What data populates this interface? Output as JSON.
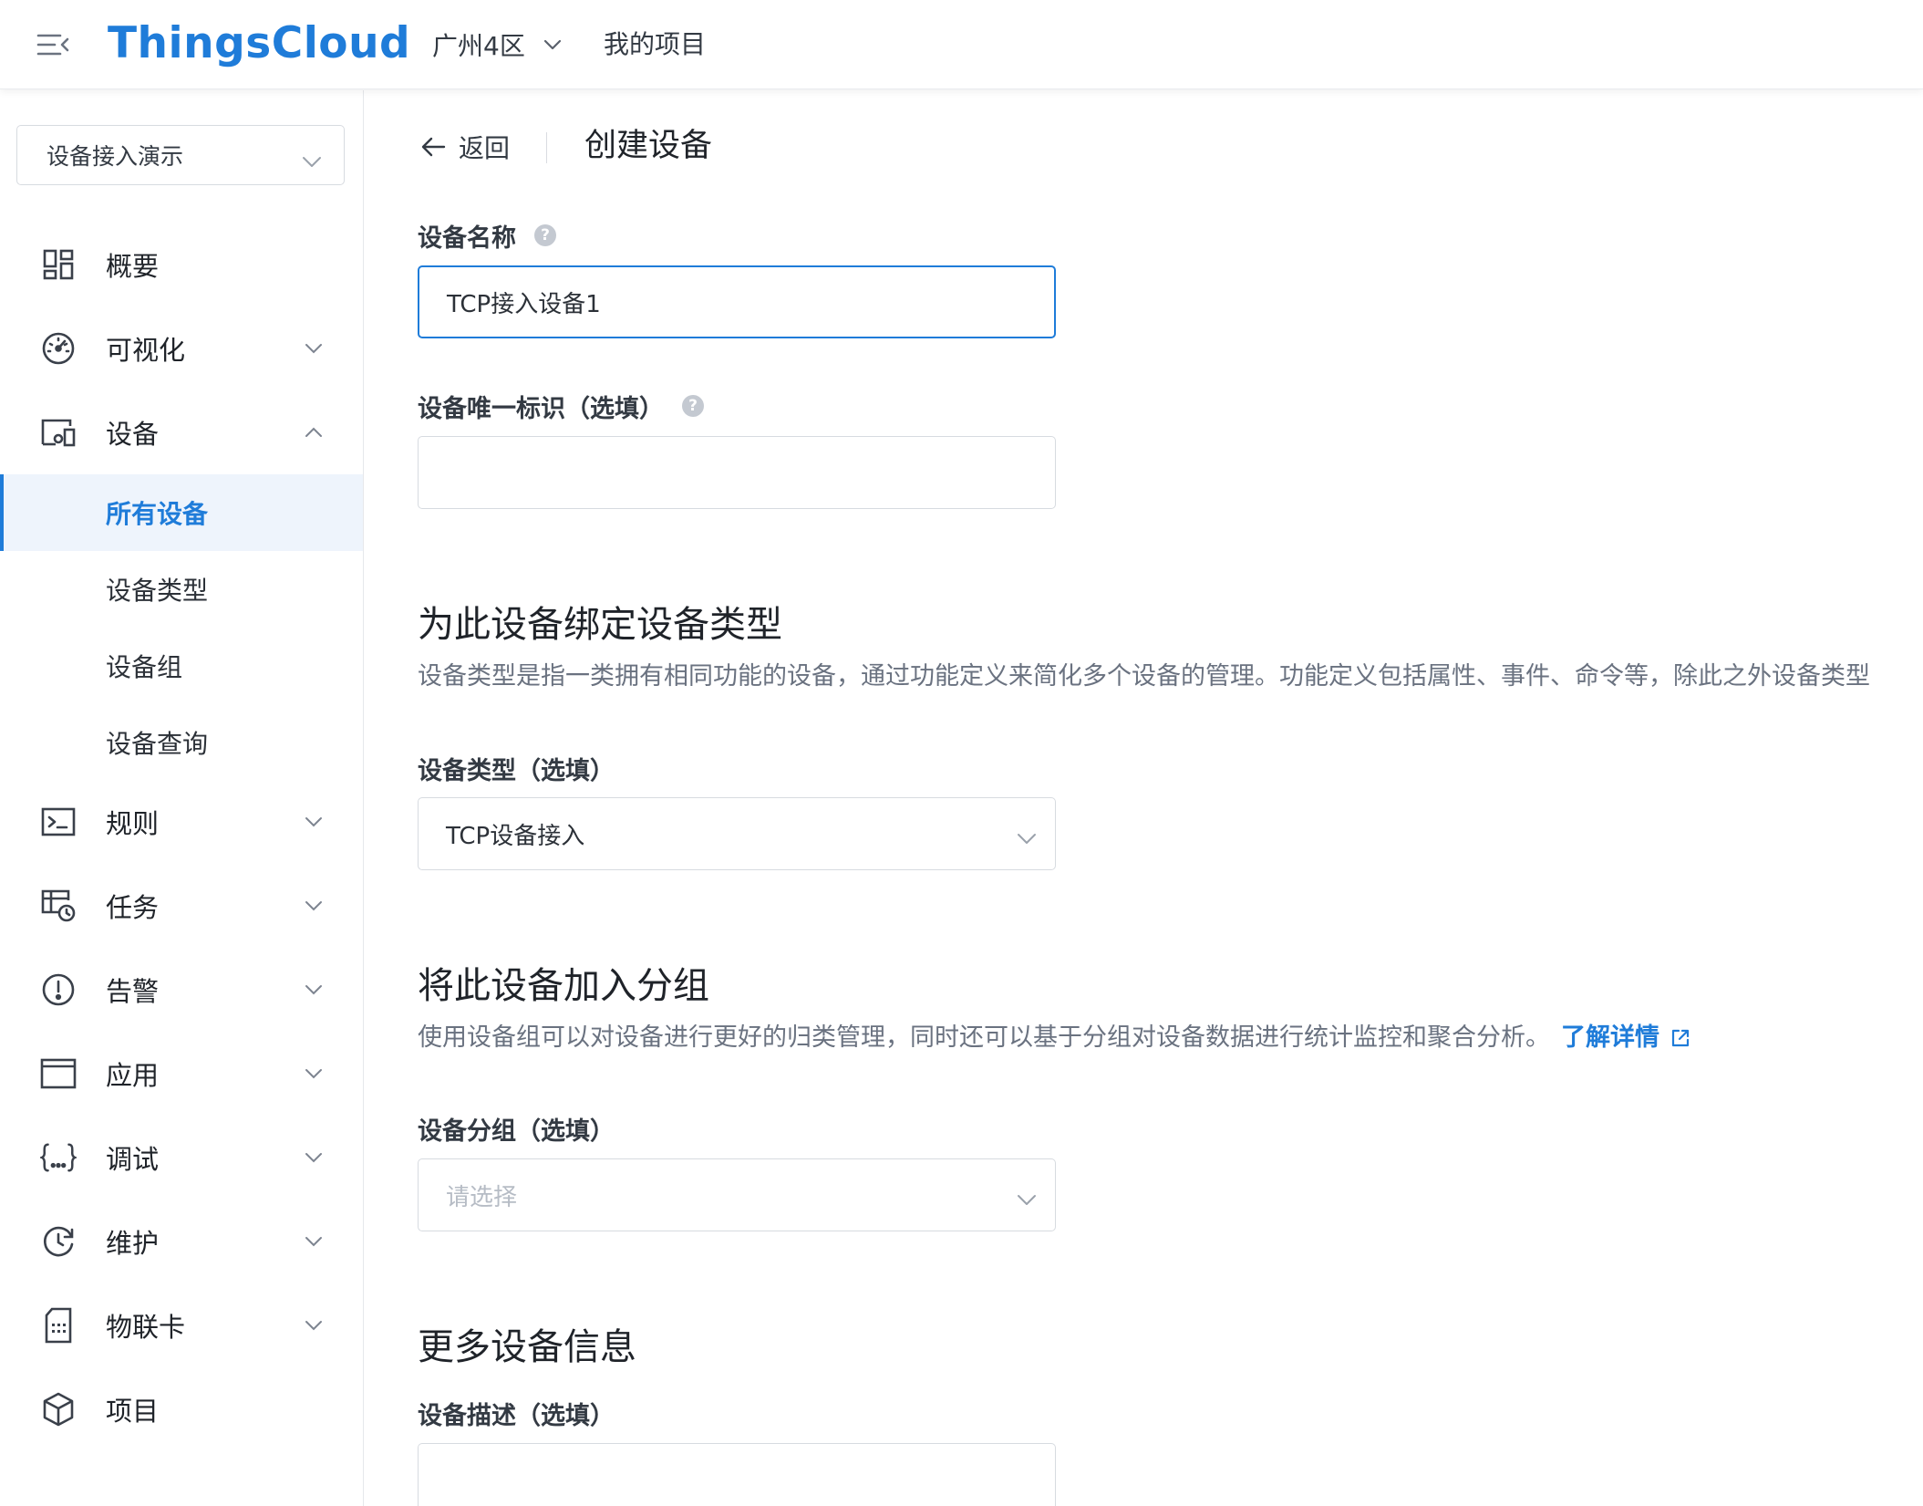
{
  "header": {
    "logo": "ThingsCloud",
    "region": "广州4区",
    "my_projects": "我的项目"
  },
  "sidebar": {
    "project_select": "设备接入演示",
    "items": [
      {
        "label": "概要",
        "icon": "dashboard-grid-icon"
      },
      {
        "label": "可视化",
        "icon": "gauge-icon"
      },
      {
        "label": "设备",
        "icon": "devices-icon"
      },
      {
        "label": "规则",
        "icon": "terminal-icon"
      },
      {
        "label": "任务",
        "icon": "task-clock-icon"
      },
      {
        "label": "告警",
        "icon": "alert-circle-icon"
      },
      {
        "label": "应用",
        "icon": "app-window-icon"
      },
      {
        "label": "调试",
        "icon": "braces-icon"
      },
      {
        "label": "维护",
        "icon": "maintenance-clock-icon"
      },
      {
        "label": "物联卡",
        "icon": "sim-card-icon"
      },
      {
        "label": "项目",
        "icon": "cube-icon"
      }
    ],
    "device_subitems": [
      {
        "label": "所有设备",
        "active": true
      },
      {
        "label": "设备类型",
        "active": false
      },
      {
        "label": "设备组",
        "active": false
      },
      {
        "label": "设备查询",
        "active": false
      }
    ]
  },
  "main": {
    "back_label": "返回",
    "page_title": "创建设备",
    "device_name": {
      "label": "设备名称",
      "value": "TCP接入设备1"
    },
    "device_id": {
      "label": "设备唯一标识（选填）",
      "value": ""
    },
    "bind_type_section": {
      "title": "为此设备绑定设备类型",
      "desc": "设备类型是指一类拥有相同功能的设备，通过功能定义来简化多个设备的管理。功能定义包括属性、事件、命令等，除此之外设备类型"
    },
    "device_type": {
      "label": "设备类型（选填）",
      "value": "TCP设备接入"
    },
    "group_section": {
      "title": "将此设备加入分组",
      "desc": "使用设备组可以对设备进行更好的归类管理，同时还可以基于分组对设备数据进行统计监控和聚合分析。",
      "link": "了解详情"
    },
    "device_group": {
      "label": "设备分组（选填）",
      "placeholder": "请选择"
    },
    "more_section": {
      "title": "更多设备信息"
    },
    "device_desc": {
      "label": "设备描述（选填）",
      "value": ""
    }
  },
  "colors": {
    "accent": "#1f7cd9",
    "active_bg": "#eef4fc",
    "border": "#d7dbe0"
  }
}
